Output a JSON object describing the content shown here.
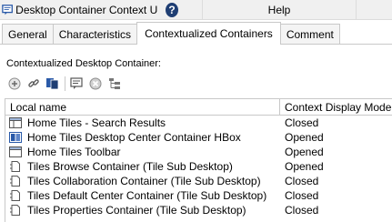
{
  "window": {
    "title": "Desktop Container Context Univ...",
    "help_label": "Help"
  },
  "tabs": [
    {
      "label": "General",
      "active": false
    },
    {
      "label": "Characteristics",
      "active": false
    },
    {
      "label": "Contextualized Containers",
      "active": true
    },
    {
      "label": "Comment",
      "active": false
    }
  ],
  "section": {
    "label": "Contextualized Desktop Container:"
  },
  "toolbar": {
    "icons": [
      "add-icon",
      "link-icon",
      "copy-icon",
      "comment-icon",
      "remove-icon",
      "tree-icon"
    ]
  },
  "table": {
    "columns": [
      "Local name",
      "Context Display Mode"
    ],
    "rows": [
      {
        "name": "Home Tiles - Search Results",
        "mode": "Closed",
        "icon": "window-icon"
      },
      {
        "name": "Home Tiles Desktop Center Container HBox",
        "mode": "Opened",
        "icon": "hbox-icon"
      },
      {
        "name": "Home Tiles Toolbar",
        "mode": "Opened",
        "icon": "window-icon"
      },
      {
        "name": "Tiles Browse Container (Tile Sub Desktop)",
        "mode": "Opened",
        "icon": "document-icon"
      },
      {
        "name": "Tiles Collaboration Container (Tile Sub Desktop)",
        "mode": "Closed",
        "icon": "document-icon"
      },
      {
        "name": "Tiles Default Center Container (Tile Sub Desktop)",
        "mode": "Closed",
        "icon": "document-icon"
      },
      {
        "name": "Tiles Properties Container (Tile Sub Desktop)",
        "mode": "Closed",
        "icon": "document-icon"
      }
    ]
  },
  "colors": {
    "help_icon_bg": "#1f3e73",
    "app_icon": "#2a5aa8",
    "border": "#c8c8c8"
  }
}
